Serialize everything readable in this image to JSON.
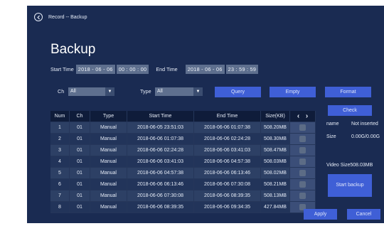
{
  "breadcrumb": "Record -- Backup",
  "page_title": "Backup",
  "start_time": {
    "label": "Start Time",
    "date": "2018 - 06 - 06",
    "time": "00 : 00 : 00"
  },
  "end_time": {
    "label": "End Time",
    "date": "2018 - 06 - 06",
    "time": "23 : 59 : 59"
  },
  "filters": {
    "ch_label": "Ch",
    "ch_value": "All",
    "type_label": "Type",
    "type_value": "All"
  },
  "buttons": {
    "query": "Query",
    "empty": "Empty",
    "format": "Format",
    "check": "Check",
    "start_backup": "Start backup",
    "apply": "Apply",
    "cancel": "Cancel"
  },
  "table": {
    "headers": [
      "Num",
      "Ch",
      "Type",
      "Start Time",
      "End Time",
      "Size(KB)"
    ],
    "rows": [
      [
        "1",
        "01",
        "Manual",
        "2018-06-05 23:51:03",
        "2018-06-06 01:07:38",
        "508.20MB"
      ],
      [
        "2",
        "01",
        "Manual",
        "2018-06-06 01:07:38",
        "2018-06-06 02:24:28",
        "508.30MB"
      ],
      [
        "3",
        "01",
        "Manual",
        "2018-06-06 02:24:28",
        "2018-06-06 03:41:03",
        "508.47MB"
      ],
      [
        "4",
        "01",
        "Manual",
        "2018-06-06 03:41:03",
        "2018-06-06 04:57:38",
        "508.03MB"
      ],
      [
        "5",
        "01",
        "Manual",
        "2018-06-06 04:57:38",
        "2018-06-06 06:13:46",
        "508.02MB"
      ],
      [
        "6",
        "01",
        "Manual",
        "2018-06-06 06:13:46",
        "2018-06-06 07:30:08",
        "508.21MB"
      ],
      [
        "7",
        "01",
        "Manual",
        "2018-06-06 07:30:08",
        "2018-06-06 08:39:35",
        "508.13MB"
      ],
      [
        "8",
        "01",
        "Manual",
        "2018-06-06 08:39:35",
        "2018-06-06 09:34:35",
        "427.84MB"
      ]
    ]
  },
  "device": {
    "name_label": "name",
    "name_value": "Not inserted",
    "size_label": "Size",
    "size_value": "0.00G/0.00G",
    "video_size": "Video Size508.03MB"
  },
  "icons": {
    "back": "back-arrow-icon",
    "prev": "chevron-left-icon",
    "next": "chevron-right-icon"
  },
  "colors": {
    "background": "#1a2b52",
    "button": "#3f5fd6",
    "header_row": "#0f1c3a"
  }
}
